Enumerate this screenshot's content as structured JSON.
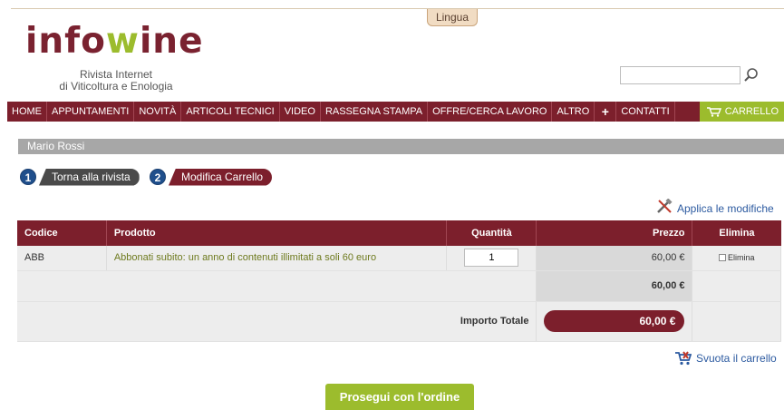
{
  "header": {
    "lingua_label": "Lingua",
    "logo": {
      "part1": "info",
      "part2": "w",
      "part3": "ine"
    },
    "tagline_line1": "Rivista Internet",
    "tagline_line2": "di Viticoltura e Enologia",
    "search": {
      "value": "",
      "placeholder": ""
    }
  },
  "nav": {
    "items": [
      "HOME",
      "APPUNTAMENTI",
      "NOVITÀ",
      "ARTICOLI TECNICI",
      "VIDEO",
      "RASSEGNA STAMPA",
      "OFFRE/CERCA LAVORO",
      "ALTRO",
      "+",
      "CONTATTI"
    ],
    "cart_label": "CARRELLO"
  },
  "user": {
    "name": "Mario Rossi"
  },
  "steps": [
    {
      "num": "1",
      "label": "Torna alla rivista"
    },
    {
      "num": "2",
      "label": "Modifica Carrello"
    }
  ],
  "apply_label": "Applica le modifiche",
  "table": {
    "headers": [
      "Codice",
      "Prodotto",
      "Quantità",
      "Prezzo",
      "Elimina"
    ],
    "rows": [
      {
        "code": "ABB",
        "product": "Abbonati subito: un anno di contenuti illimitati a soli 60 euro",
        "quantity": "1",
        "price": "60,00 €",
        "delete_label": "Elimina"
      }
    ],
    "subtotal": "60,00 €",
    "total_label": "Importo Totale",
    "total_value": "60,00 €"
  },
  "svuota_label": "Svuota il carrello",
  "prosegui_label": "Prosegui con l'ordine",
  "colors": {
    "brand": "#7c1f2c",
    "accent_green": "#9cbc2d",
    "step_blue": "#1f4f8c",
    "link_blue": "#2c5aa0"
  }
}
